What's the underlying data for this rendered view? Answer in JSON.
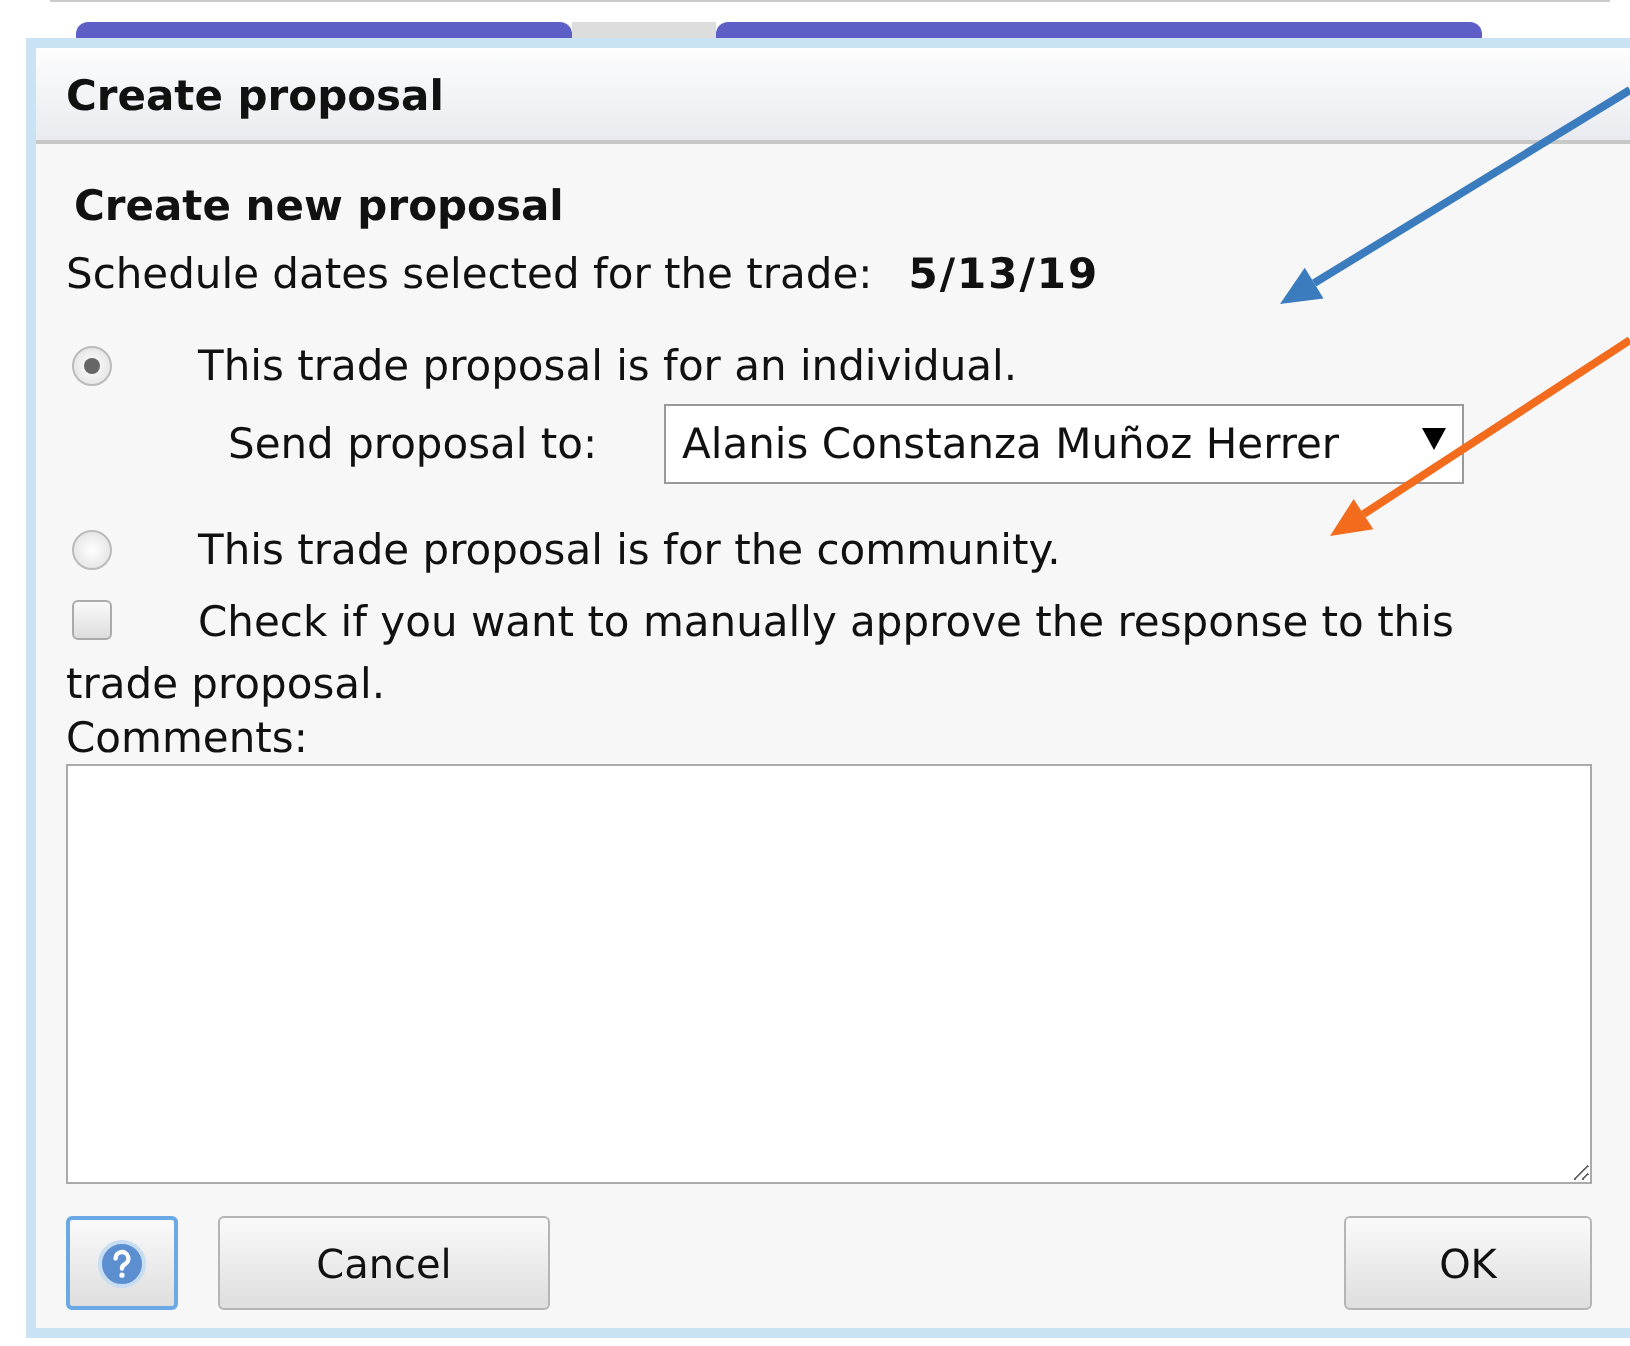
{
  "window": {
    "title": "Create proposal"
  },
  "heading": "Create new proposal",
  "schedule": {
    "label": "Schedule dates selected for the trade:",
    "value": "5/13/19"
  },
  "options": [
    {
      "kind": "radio",
      "label": "This trade proposal is for an individual.",
      "selected": true
    },
    {
      "kind": "select",
      "label": "Send proposal to:",
      "value": "Alanis Constanza Muñoz Herrer"
    },
    {
      "kind": "radio",
      "label": "This trade proposal is for the community.",
      "selected": false
    },
    {
      "kind": "checkbox",
      "label": "Check if you want to manually approve the response to this trade proposal.",
      "checked": false
    }
  ],
  "comments": {
    "label": "Comments:"
  },
  "buttons": [
    {
      "kind": "help"
    },
    {
      "kind": "text",
      "label": "Cancel"
    },
    {
      "kind": "text",
      "label": "OK"
    }
  ],
  "annotations": [
    {
      "color": "#3a7cbd"
    },
    {
      "color": "#f36b1c"
    }
  ]
}
